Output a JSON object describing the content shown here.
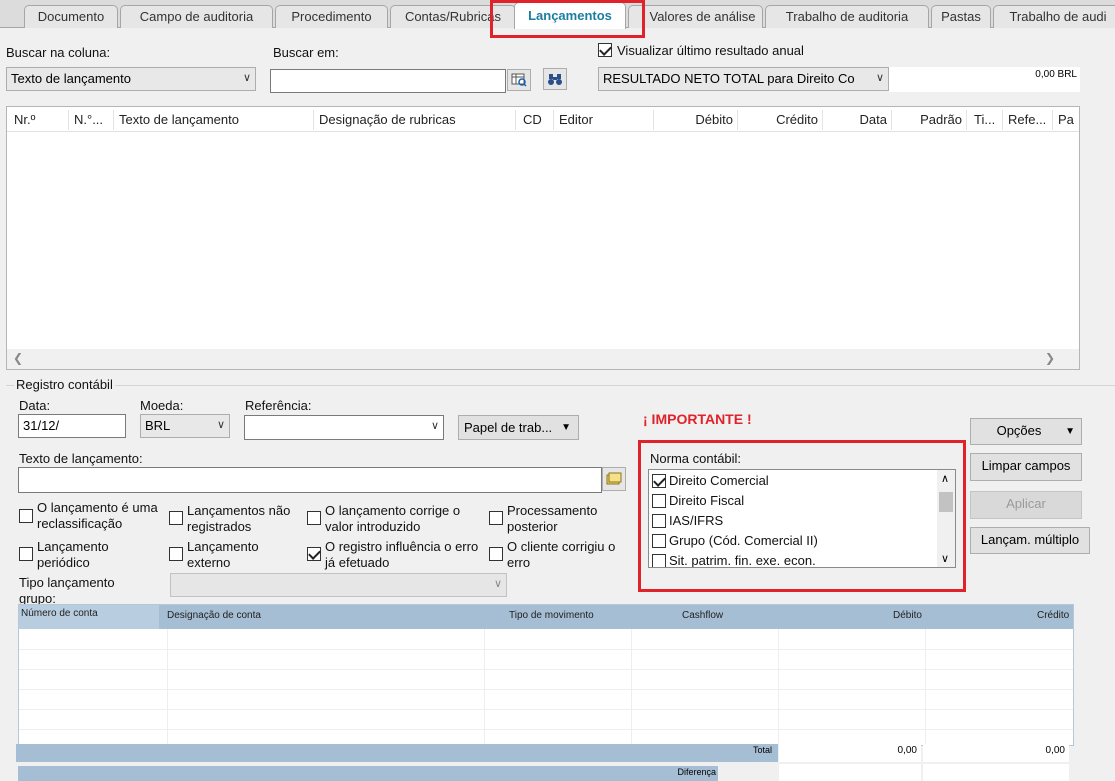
{
  "tabs": [
    "Documento",
    "Campo de auditoria",
    "Procedimento",
    "Contas/Rubricas",
    "Lançamentos",
    "Valores de análise",
    "Trabalho de auditoria",
    "Pastas",
    "Trabalho de audi"
  ],
  "search": {
    "column_label": "Buscar na coluna:",
    "column_value": "Texto de lançamento",
    "in_label": "Buscar em:",
    "in_value": ""
  },
  "annual": {
    "checkbox_label": "Visualizar último resultado anual",
    "result_select": "RESULTADO NETO TOTAL para Direito Co",
    "amount": "0,00 BRL"
  },
  "grid": {
    "columns": [
      "Nr.º",
      "N.°...",
      "Texto de lançamento",
      "Designação de rubricas",
      "CD",
      "Editor",
      "Débito",
      "Crédito",
      "Data",
      "Padrão",
      "Ti...",
      "Refe...",
      "Pa"
    ]
  },
  "registro": {
    "group_label": "Registro contábil",
    "data_label": "Data:",
    "data_value": "31/12/",
    "moeda_label": "Moeda:",
    "moeda_value": "BRL",
    "referencia_label": "Referência:",
    "referencia_value": "",
    "papel_button": "Papel de trab...",
    "texto_label": "Texto de lançamento:",
    "texto_value": "",
    "tipo_label": "Tipo lançamento grupo:"
  },
  "checkboxes": [
    {
      "label": "O lançamento é uma reclassificação",
      "checked": false
    },
    {
      "label": "Lançamentos não registrados",
      "checked": false
    },
    {
      "label": "O lançamento corrige o valor introduzido",
      "checked": false
    },
    {
      "label": "Processamento posterior",
      "checked": false
    },
    {
      "label": "Lançamento periódico",
      "checked": false
    },
    {
      "label": "Lançamento externo",
      "checked": false
    },
    {
      "label": "O registro influência o erro já efetuado",
      "checked": true
    },
    {
      "label": "O cliente corrigiu o erro",
      "checked": false
    }
  ],
  "important": "¡ IMPORTANTE !",
  "norma": {
    "label": "Norma contábil:",
    "items": [
      {
        "label": "Direito Comercial",
        "checked": true
      },
      {
        "label": "Direito Fiscal",
        "checked": false
      },
      {
        "label": "IAS/IFRS",
        "checked": false
      },
      {
        "label": "Grupo (Cód. Comercial II)",
        "checked": false
      },
      {
        "label": "Sit. patrim. fin. exe. econ.",
        "checked": false
      }
    ]
  },
  "buttons": {
    "opcoes": "Opções",
    "limpar": "Limpar campos",
    "aplicar": "Aplicar",
    "multiplo": "Lançam. múltiplo"
  },
  "bottom_table": {
    "columns": [
      "Número de conta",
      "Designação de conta",
      "Tipo de movimento",
      "Cashflow",
      "Débito",
      "Crédito"
    ],
    "total_label": "Total",
    "total_debito": "0,00",
    "total_credito": "0,00",
    "diff_label": "Diferença"
  },
  "colors": {
    "highlight": "#e0222a",
    "active_tab": "#1b7ea1",
    "table_header": "#a5bed4"
  }
}
